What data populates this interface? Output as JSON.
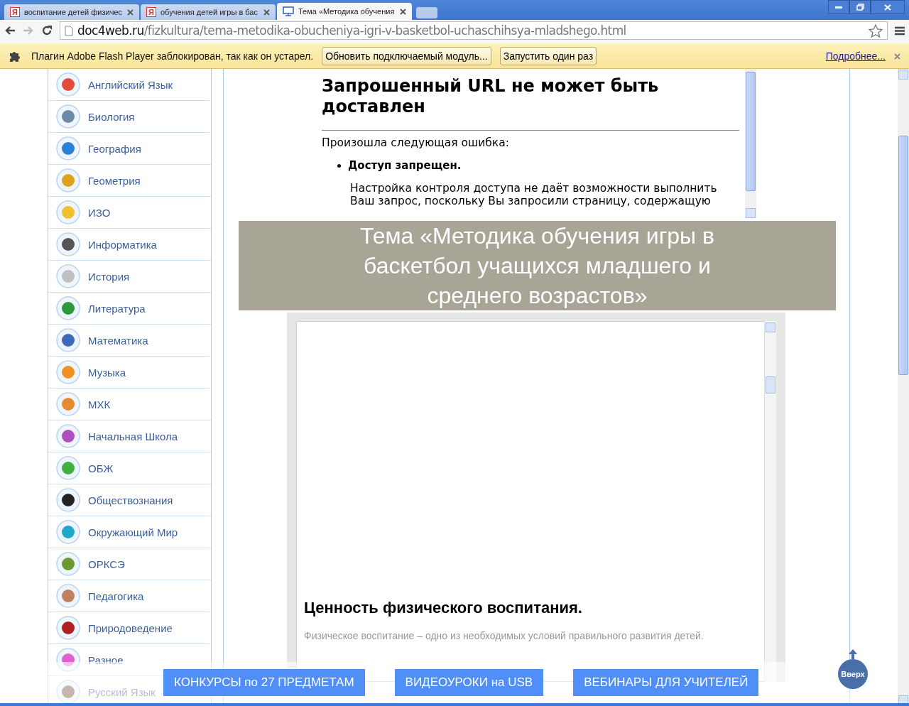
{
  "tabs": [
    {
      "kind": "letter",
      "glyph": "Я",
      "label": "воспитание детей физичес",
      "selected": false
    },
    {
      "kind": "letter",
      "glyph": "Я",
      "label": "обучения детей игры в бас",
      "selected": false
    },
    {
      "kind": "monitor",
      "label": "Тема «Методика обучения",
      "selected": true
    }
  ],
  "address_bar": {
    "host": "doc4web.ru",
    "path": "/fizkultura/tema-metodika-obucheniya-igri-v-basketbol-uchaschihsya-mladshego.html"
  },
  "info_bar": {
    "message": "Плагин Adobe Flash Player заблокирован, так как он устарел.",
    "buttons": [
      "Обновить подключаемый модуль...",
      "Запустить один раз"
    ],
    "link": "Подробнее..."
  },
  "sidebar": {
    "items": [
      {
        "label": "Английский Язык"
      },
      {
        "label": "Биология"
      },
      {
        "label": "География"
      },
      {
        "label": "Геометрия"
      },
      {
        "label": "ИЗО"
      },
      {
        "label": "Информатика"
      },
      {
        "label": "История"
      },
      {
        "label": "Литература"
      },
      {
        "label": "Математика"
      },
      {
        "label": "Музыка"
      },
      {
        "label": "МХК"
      },
      {
        "label": "Начальная Школа"
      },
      {
        "label": "ОБЖ"
      },
      {
        "label": "Обществознания"
      },
      {
        "label": "Окружающий Мир"
      },
      {
        "label": "ОРКСЭ"
      },
      {
        "label": "Педагогика"
      },
      {
        "label": "Природоведение"
      },
      {
        "label": "Разное"
      },
      {
        "label": "Русский Язык"
      }
    ]
  },
  "error_frame": {
    "heading": "Запрошенный URL не может быть доставлен",
    "intro": "Произошла следующая ошибка:",
    "error": "Доступ запрещен.",
    "details": "Настройка контроля доступа не даёт возможности выполнить Ваш запрос, поскольку Вы запросили страницу, содержащую"
  },
  "page_title": "Тема «Методика обучения игры в баскетбол учащихся младшего и среднего возрастов»",
  "document_frame": {
    "heading": "Ценность физического воспитания.",
    "paragraph": "Физическое воспитание – одно из необходимых условий правильного развития детей."
  },
  "bottom_bar": {
    "buttons": [
      "КОНКУРСЫ по 27 ПРЕДМЕТАМ",
      "ВИДЕОУРОКИ на USB",
      "ВЕБИНАРЫ ДЛЯ УЧИТЕЛЕЙ"
    ],
    "top_button": "Вверх"
  }
}
